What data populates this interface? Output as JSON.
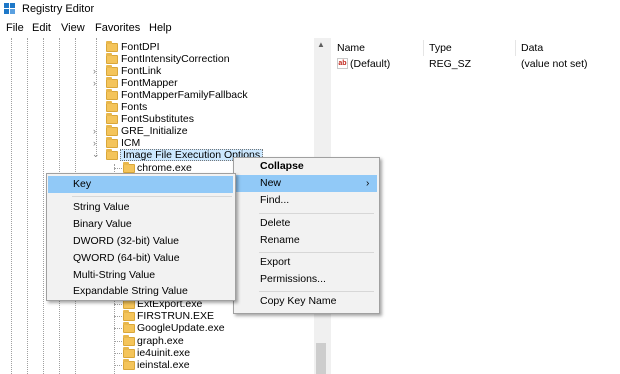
{
  "window": {
    "title": "Registry Editor"
  },
  "menubar": {
    "items": [
      "File",
      "Edit",
      "View",
      "Favorites",
      "Help"
    ]
  },
  "tree": {
    "items": [
      {
        "label": "FontDPI",
        "expander": ""
      },
      {
        "label": "FontIntensityCorrection",
        "expander": ""
      },
      {
        "label": "FontLink",
        "expander": "›"
      },
      {
        "label": "FontMapper",
        "expander": "›"
      },
      {
        "label": "FontMapperFamilyFallback",
        "expander": ""
      },
      {
        "label": "Fonts",
        "expander": ""
      },
      {
        "label": "FontSubstitutes",
        "expander": ""
      },
      {
        "label": "GRE_Initialize",
        "expander": "›"
      },
      {
        "label": "ICM",
        "expander": "›"
      },
      {
        "label": "Image File Execution Options",
        "expander": "⌄"
      },
      {
        "label": "chrome.exe",
        "expander": ""
      }
    ],
    "lower_items": [
      "ExtExport.exe",
      "FIRSTRUN.EXE",
      "GoogleUpdate.exe",
      "graph.exe",
      "ie4uinit.exe",
      "ieinstal.exe"
    ]
  },
  "list": {
    "headers": {
      "name": "Name",
      "type": "Type",
      "data": "Data"
    },
    "rows": [
      {
        "name": "(Default)",
        "type": "REG_SZ",
        "data": "(value not set)",
        "icon": "ab-string-value-icon"
      }
    ]
  },
  "context_menu": {
    "collapse": "Collapse",
    "new": "New",
    "find": "Find...",
    "delete": "Delete",
    "rename": "Rename",
    "export": "Export",
    "permissions": "Permissions...",
    "copy_key_name": "Copy Key Name"
  },
  "submenu": {
    "key": "Key",
    "string_value": "String Value",
    "binary_value": "Binary Value",
    "dword_value": "DWORD (32-bit) Value",
    "qword_value": "QWORD (64-bit) Value",
    "multi_string_value": "Multi-String Value",
    "expandable_string_value": "Expandable String Value"
  },
  "colors": {
    "selection": "#91c9f7",
    "menu_bg": "#f2f2f2",
    "folder": "#f4c45a"
  }
}
